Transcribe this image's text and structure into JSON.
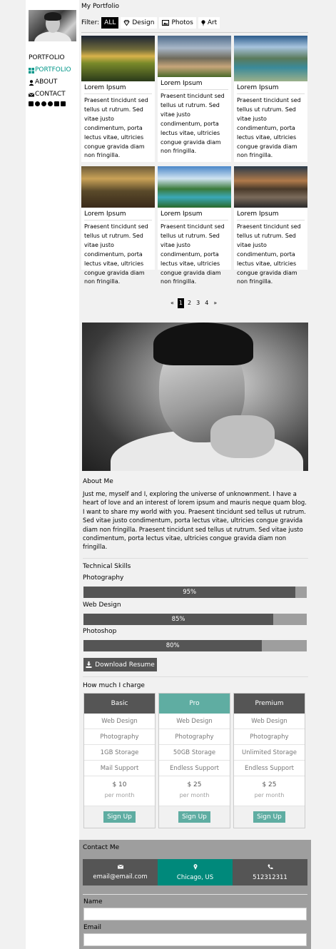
{
  "sidebar": {
    "nav": [
      {
        "label": "PORTFOLIO",
        "icon": ""
      },
      {
        "label": "PORTFOLIO",
        "icon": "grid-icon"
      },
      {
        "label": "ABOUT",
        "icon": "user-icon"
      },
      {
        "label": "CONTACT",
        "icon": "envelope-icon"
      }
    ],
    "social_icons": [
      "facebook-icon",
      "instagram-icon",
      "snapchat-icon",
      "pinterest-icon",
      "twitter-icon",
      "linkedin-icon"
    ],
    "accent_color": "#009688"
  },
  "header": {
    "title": "My Portfolio",
    "filter_label": "Filter:",
    "filters": [
      {
        "label": "ALL",
        "icon": "",
        "active": true
      },
      {
        "label": "Design",
        "icon": "diamond-icon",
        "active": false
      },
      {
        "label": "Photos",
        "icon": "photo-icon",
        "active": false
      },
      {
        "label": "Art",
        "icon": "map-marker-icon",
        "active": false
      }
    ]
  },
  "gallery": [
    {
      "caption": "Lorem Ipsum",
      "text": "Praesent tincidunt sed tellus ut rutrum. Sed vitae justo condimentum, porta lectus vitae, ultricies congue gravida diam non fringilla."
    },
    {
      "caption": "Lorem Ipsum",
      "text": "Praesent tincidunt sed tellus ut rutrum. Sed vitae justo condimentum, porta lectus vitae, ultricies congue gravida diam non fringilla."
    },
    {
      "caption": "Lorem Ipsum",
      "text": "Praesent tincidunt sed tellus ut rutrum. Sed vitae justo condimentum, porta lectus vitae, ultricies congue gravida diam non fringilla."
    },
    {
      "caption": "Lorem Ipsum",
      "text": "Praesent tincidunt sed tellus ut rutrum. Sed vitae justo condimentum, porta lectus vitae, ultricies congue gravida diam non fringilla."
    },
    {
      "caption": "Lorem Ipsum",
      "text": "Praesent tincidunt sed tellus ut rutrum. Sed vitae justo condimentum, porta lectus vitae, ultricies congue gravida diam non fringilla."
    },
    {
      "caption": "Lorem Ipsum",
      "text": "Praesent tincidunt sed tellus ut rutrum. Sed vitae justo condimentum, porta lectus vitae, ultricies congue gravida diam non fringilla."
    }
  ],
  "pagination": {
    "prev": "«",
    "pages": [
      "1",
      "2",
      "3",
      "4"
    ],
    "current": "1",
    "next": "»"
  },
  "about": {
    "title": "About Me",
    "text": "Just me, myself and I, exploring the universe of unknownment. I have a heart of love and an interest of lorem ipsum and mauris neque quam blog. I want to share my world with you. Praesent tincidunt sed tellus ut rutrum. Sed vitae justo condimentum, porta lectus vitae, ultricies congue gravida diam non fringilla. Praesent tincidunt sed tellus ut rutrum. Sed vitae justo condimentum, porta lectus vitae, ultricies congue gravida diam non fringilla."
  },
  "skills": {
    "title": "Technical Skills",
    "items": [
      {
        "label": "Photography",
        "percent": 95,
        "text": "95%"
      },
      {
        "label": "Web Design",
        "percent": 85,
        "text": "85%"
      },
      {
        "label": "Photoshop",
        "percent": 80,
        "text": "80%"
      }
    ],
    "download_label": "Download Resume"
  },
  "pricing": {
    "title": "How much I charge",
    "plans": [
      {
        "name": "Basic",
        "features": [
          "Web Design",
          "Photography",
          "1GB Storage",
          "Mail Support"
        ],
        "price": "$ 10",
        "period": "per month",
        "button": "Sign Up"
      },
      {
        "name": "Pro",
        "features": [
          "Web Design",
          "Photography",
          "50GB Storage",
          "Endless Support"
        ],
        "price": "$ 25",
        "period": "per month",
        "button": "Sign Up"
      },
      {
        "name": "Premium",
        "features": [
          "Web Design",
          "Photography",
          "Unlimited Storage",
          "Endless Support"
        ],
        "price": "$ 25",
        "period": "per month",
        "button": "Sign Up"
      }
    ],
    "highlight_color": "#5fada2"
  },
  "contact": {
    "title": "Contact Me",
    "email": "email@email.com",
    "location": "Chicago, US",
    "phone": "512312311",
    "name_label": "Name",
    "email_label": "Email"
  }
}
